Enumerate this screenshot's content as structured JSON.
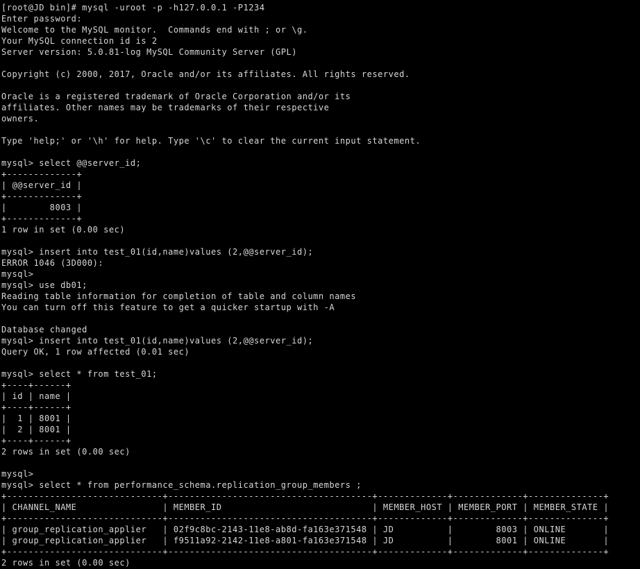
{
  "terminal": {
    "title": "root@JD:/usr/local/mysql/bin",
    "background_color": "#000000",
    "foreground_color": "#d8d8d8",
    "scrollback_fragment_color": "#5a0d0d",
    "columns": 125,
    "rows": 51,
    "scrollback_fragment": "                                                                 ..   ..",
    "session": {
      "shell_prompt": "[root@JD bin]#",
      "command": "mysql -uroot -p -h127.0.0.1 -P1234",
      "password_prompt": "Enter password:",
      "mysql_prompt": "mysql>",
      "host": "127.0.0.1",
      "port": "1234",
      "user": "root",
      "hostname": "JD",
      "connection_id": "2",
      "server_version": "5.0.81-log MySQL Community Server (GPL)",
      "database": "db01"
    },
    "lines": [
      "[root@JD bin]# mysql -uroot -p -h127.0.0.1 -P1234",
      "Enter password:",
      "Welcome to the MySQL monitor.  Commands end with ; or \\g.",
      "Your MySQL connection id is 2",
      "Server version: 5.0.81-log MySQL Community Server (GPL)",
      "",
      "Copyright (c) 2000, 2017, Oracle and/or its affiliates. All rights reserved.",
      "",
      "Oracle is a registered trademark of Oracle Corporation and/or its",
      "affiliates. Other names may be trademarks of their respective",
      "owners.",
      "",
      "Type 'help;' or '\\h' for help. Type '\\c' to clear the current input statement.",
      "",
      "mysql> select @@server_id;",
      "+-------------+",
      "| @@server_id |",
      "+-------------+",
      "|        8003 |",
      "+-------------+",
      "1 row in set (0.00 sec)",
      "",
      "mysql> insert into test_01(id,name)values (2,@@server_id);",
      "ERROR 1046 (3D000):",
      "mysql>",
      "mysql> use db01;",
      "Reading table information for completion of table and column names",
      "You can turn off this feature to get a quicker startup with -A",
      "",
      "Database changed",
      "mysql> insert into test_01(id,name)values (2,@@server_id);",
      "Query OK, 1 row affected (0.01 sec)",
      "",
      "mysql> select * from test_01;",
      "+----+------+",
      "| id | name |",
      "+----+------+",
      "|  1 | 8001 |",
      "|  2 | 8001 |",
      "+----+------+",
      "2 rows in set (0.00 sec)",
      "",
      "mysql>",
      "mysql> select * from performance_schema.replication_group_members ;",
      "+-----------------------------+--------------------------------------+-------------+-------------+--------------+",
      "| CHANNEL_NAME                | MEMBER_ID                            | MEMBER_HOST | MEMBER_PORT | MEMBER_STATE |",
      "+-----------------------------+--------------------------------------+-------------+-------------+--------------+",
      "| group_replication_applier   | 02f9c8bc-2143-11e8-ab8d-fa163e371548 | JD          |        8003 | ONLINE       |",
      "| group_replication_applier   | f9511a92-2142-11e8-a801-fa163e371548 | JD          |        8001 | ONLINE       |",
      "+-----------------------------+--------------------------------------+-------------+-------------+--------------+",
      "2 rows in set (0.00 sec)"
    ],
    "queries": [
      {
        "prompt": "mysql>",
        "sql": "select @@server_id;",
        "result_columns": [
          "@@server_id"
        ],
        "result_rows": [
          [
            "8003"
          ]
        ],
        "status": "1 row in set (0.00 sec)"
      },
      {
        "prompt": "mysql>",
        "sql": "insert into test_01(id,name)values (2,@@server_id);",
        "status": "ERROR 1046 (3D000):"
      },
      {
        "prompt": "mysql>",
        "sql": "use db01;",
        "notes": [
          "Reading table information for completion of table and column names",
          "You can turn off this feature to get a quicker startup with -A"
        ],
        "status": "Database changed"
      },
      {
        "prompt": "mysql>",
        "sql": "insert into test_01(id,name)values (2,@@server_id);",
        "status": "Query OK, 1 row affected (0.01 sec)"
      },
      {
        "prompt": "mysql>",
        "sql": "select * from test_01;",
        "result_columns": [
          "id",
          "name"
        ],
        "result_rows": [
          [
            "1",
            "8001"
          ],
          [
            "2",
            "8001"
          ]
        ],
        "status": "2 rows in set (0.00 sec)"
      },
      {
        "prompt": "mysql>",
        "sql": "select * from performance_schema.replication_group_members ;",
        "result_columns": [
          "CHANNEL_NAME",
          "MEMBER_ID",
          "MEMBER_HOST",
          "MEMBER_PORT",
          "MEMBER_STATE"
        ],
        "result_rows": [
          [
            "group_replication_applier",
            "02f9c8bc-2143-11e8-ab8d-fa163e371548",
            "JD",
            "8003",
            "ONLINE"
          ],
          [
            "group_replication_applier",
            "f9511a92-2142-11e8-a801-fa163e371548",
            "JD",
            "8001",
            "ONLINE"
          ]
        ],
        "status": "2 rows in set (0.00 sec)"
      }
    ]
  }
}
